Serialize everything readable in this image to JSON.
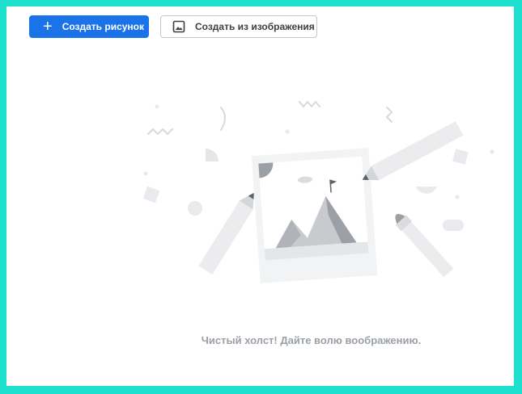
{
  "toolbar": {
    "create_drawing_label": "Создать рисунок",
    "create_from_image_label": "Создать из изображения"
  },
  "canvas": {
    "empty_message": "Чистый холст! Дайте волю воображению."
  },
  "icons": {
    "create_drawing": "plus-icon",
    "create_from_image": "image-icon"
  },
  "colors": {
    "primary": "#1a73e8",
    "border": "#1ee0cf",
    "muted_text": "#9aa0a6"
  }
}
